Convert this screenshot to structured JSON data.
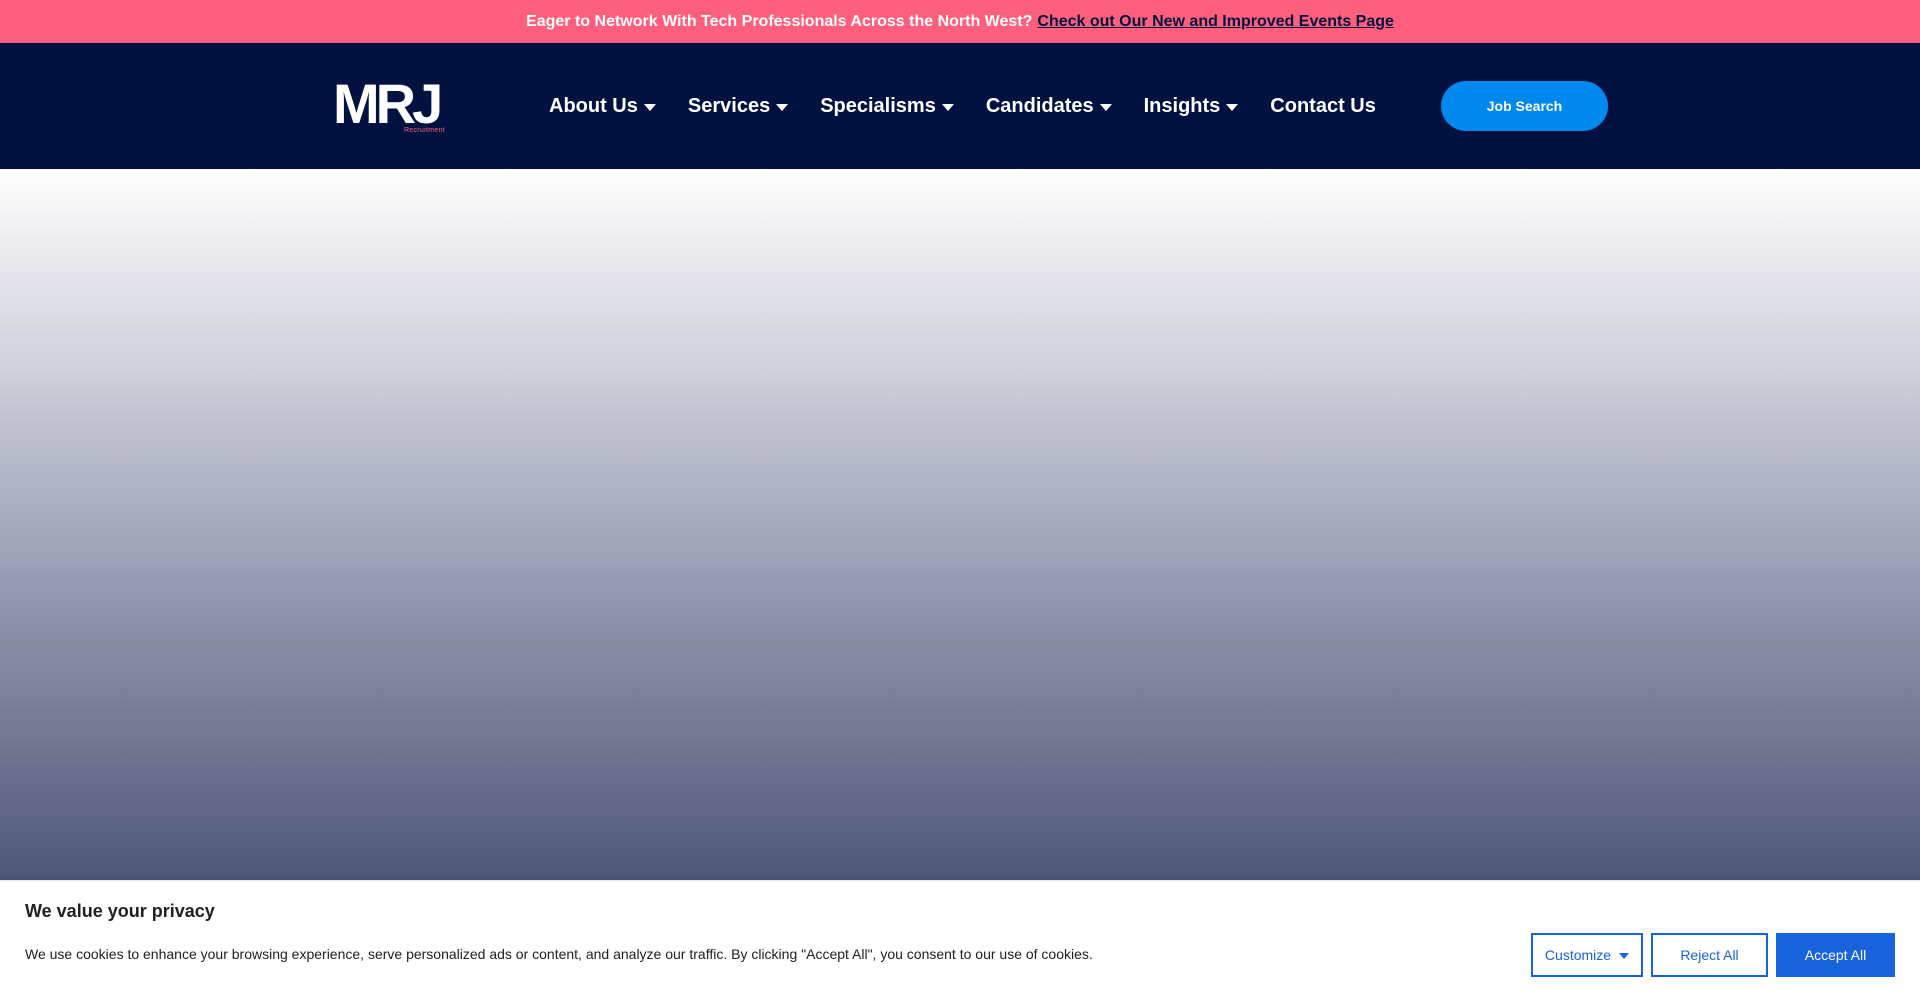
{
  "announcement": {
    "text": "Eager to Network With Tech Professionals Across the North West?",
    "link_label": "Check out Our New and Improved Events Page"
  },
  "header": {
    "logo": {
      "mark": "MRJ",
      "sub": "Recruitment"
    },
    "nav": [
      {
        "label": "About Us",
        "has_dropdown": true
      },
      {
        "label": "Services",
        "has_dropdown": true
      },
      {
        "label": "Specialisms",
        "has_dropdown": true
      },
      {
        "label": "Candidates",
        "has_dropdown": true
      },
      {
        "label": "Insights",
        "has_dropdown": true
      },
      {
        "label": "Contact Us",
        "has_dropdown": false
      }
    ],
    "cta_label": "Job Search"
  },
  "cookie_banner": {
    "title": "We value your privacy",
    "text": "We use cookies to enhance your browsing experience, serve personalized ads or content, and analyze our traffic. By clicking \"Accept All\", you consent to our use of cookies.",
    "customize_label": "Customize",
    "reject_label": "Reject All",
    "accept_label": "Accept All"
  },
  "colors": {
    "announcement_bg": "#fe5f7c",
    "header_bg": "#011240",
    "cta_bg": "#0088ee",
    "cookie_accent": "#1863dc"
  },
  "icons": [
    "chevron-down-icon"
  ]
}
